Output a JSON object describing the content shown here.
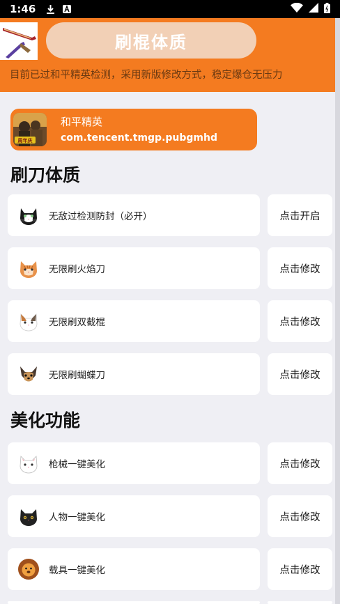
{
  "status_bar": {
    "time": "1:46"
  },
  "header": {
    "title": "刷棍体质",
    "notice": "目前已过和平精英检测，采用新版修改方式，稳定爆仓无压力"
  },
  "app": {
    "name": "和平精英",
    "package": "com.tencent.tmgp.pubgmhd"
  },
  "sections": [
    {
      "title": "刷刀体质",
      "items": [
        {
          "label": "无敌过检测防封（必开）",
          "action": "点击开启",
          "icon": "tuxedo-cat-icon"
        },
        {
          "label": "无限刷火焰刀",
          "action": "点击修改",
          "icon": "orange-cat-icon"
        },
        {
          "label": "无限刷双截棍",
          "action": "点击修改",
          "icon": "calico-cat-icon"
        },
        {
          "label": "无限刷蝴蝶刀",
          "action": "点击修改",
          "icon": "yorkie-dog-icon"
        }
      ]
    },
    {
      "title": "美化功能",
      "items": [
        {
          "label": "枪械一键美化",
          "action": "点击修改",
          "icon": "white-cat-icon"
        },
        {
          "label": "人物一键美化",
          "action": "点击修改",
          "icon": "black-cat-icon"
        },
        {
          "label": "载具一键美化",
          "action": "点击修改",
          "icon": "lion-icon"
        }
      ]
    }
  ],
  "colors": {
    "accent": "#f47b20",
    "title_pill": "#f2d0b6",
    "background": "#efeff4"
  }
}
